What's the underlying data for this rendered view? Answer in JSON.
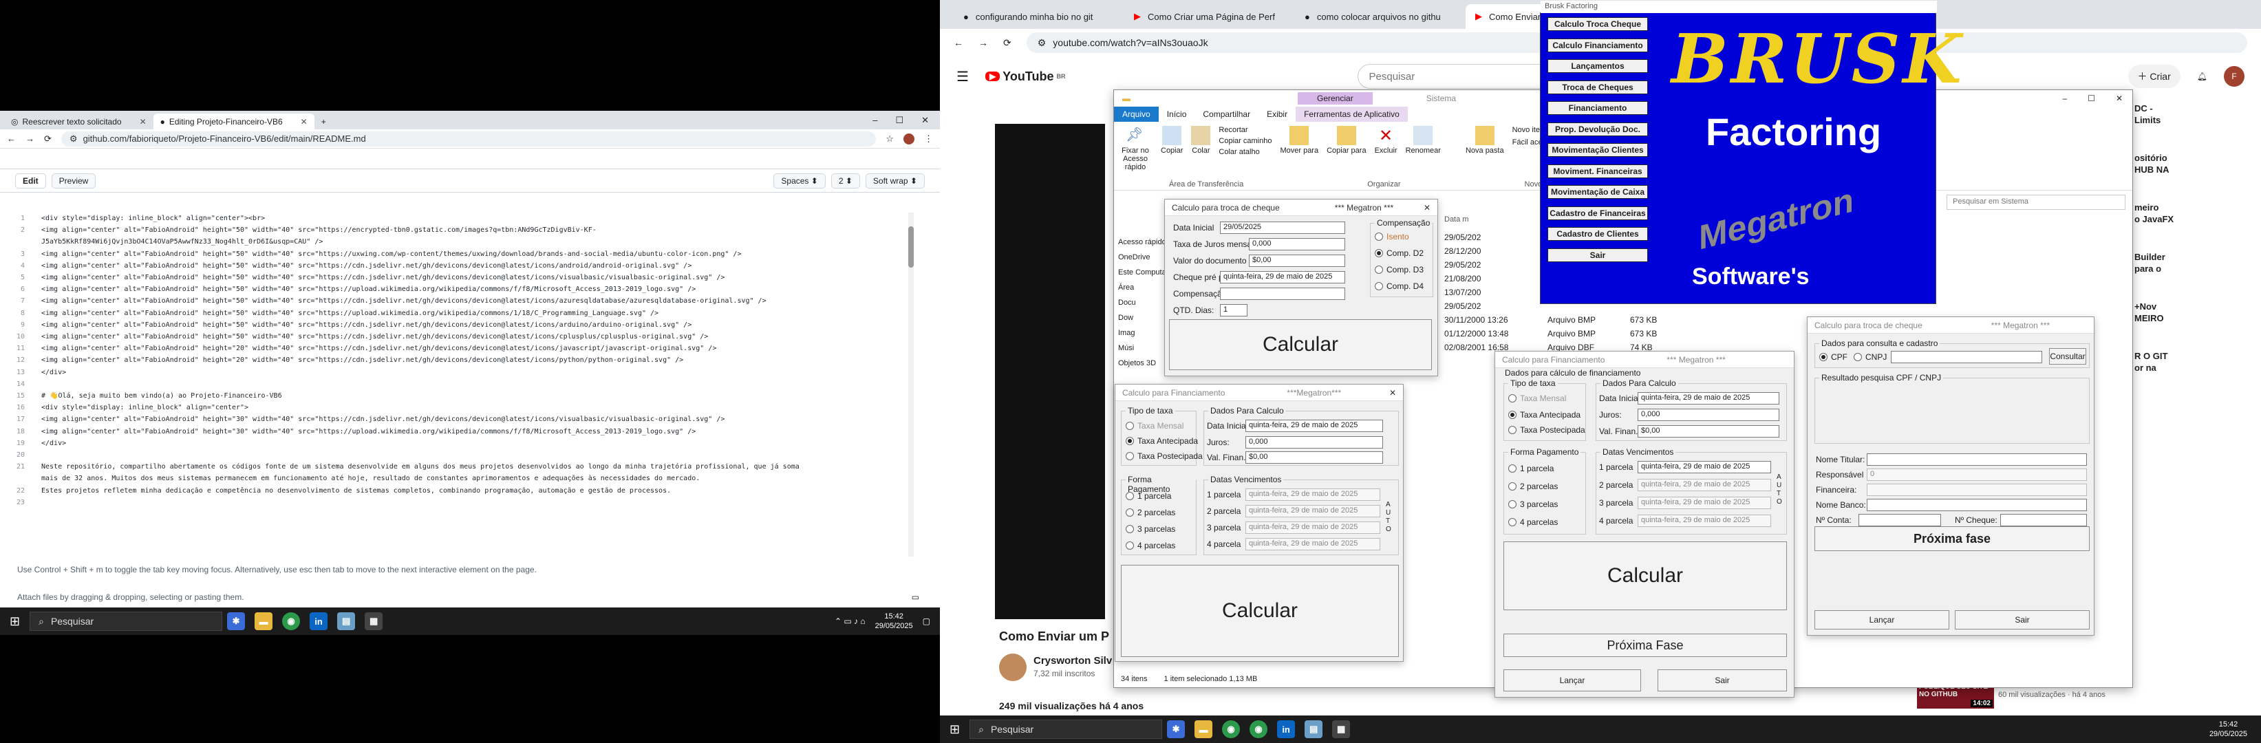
{
  "left": {
    "tabs": [
      {
        "label": "Reescrever texto solicitado",
        "active": false
      },
      {
        "label": "Editing Projeto-Financeiro-VB6",
        "active": true
      }
    ],
    "url": "github.com/fabioriqueto/Projeto-Financeiro-VB6/edit/main/README.md",
    "editor": {
      "edit_tab": "Edit",
      "preview_tab": "Preview",
      "indent_mode": "Spaces",
      "indent_size": "2",
      "wrap_mode": "Soft wrap"
    },
    "code_lines": [
      {
        "n": "1",
        "t": "<div style=\"display: inline_block\" align=\"center\"><br>"
      },
      {
        "n": "2",
        "t": "<img align=\"center\" alt=\"FabioAndroid\" height=\"50\" width=\"40\" src=\"https://encrypted-tbn0.gstatic.com/images?q=tbn:ANd9GcTzDigvBiv-KF-"
      },
      {
        "n": "",
        "t": "J5aYb5KkRf894Wi6jQvjn3bO4C14OVaP5AwwfNz33_Nog4hlt_0rD6I&usqp=CAU\" />"
      },
      {
        "n": "3",
        "t": "<img align=\"center\" alt=\"FabioAndroid\" height=\"50\" width=\"40\" src=\"https://uxwing.com/wp-content/themes/uxwing/download/brands-and-social-media/ubuntu-color-icon.png\" />"
      },
      {
        "n": "4",
        "t": "<img align=\"center\" alt=\"FabioAndroid\" height=\"50\" width=\"40\" src=\"https://cdn.jsdelivr.net/gh/devicons/devicon@latest/icons/android/android-original.svg\" />"
      },
      {
        "n": "5",
        "t": "<img align=\"center\" alt=\"FabioAndroid\" height=\"50\" width=\"40\" src=\"https://cdn.jsdelivr.net/gh/devicons/devicon@latest/icons/visualbasic/visualbasic-original.svg\" />"
      },
      {
        "n": "6",
        "t": "<img align=\"center\" alt=\"FabioAndroid\" height=\"50\" width=\"40\" src=\"https://upload.wikimedia.org/wikipedia/commons/f/f8/Microsoft_Access_2013-2019_logo.svg\" />"
      },
      {
        "n": "7",
        "t": "<img align=\"center\" alt=\"FabioAndroid\" height=\"50\" width=\"40\" src=\"https://cdn.jsdelivr.net/gh/devicons/devicon@latest/icons/azuresqldatabase/azuresqldatabase-original.svg\" />"
      },
      {
        "n": "8",
        "t": "<img align=\"center\" alt=\"FabioAndroid\" height=\"50\" width=\"40\" src=\"https://upload.wikimedia.org/wikipedia/commons/1/18/C_Programming_Language.svg\" />"
      },
      {
        "n": "9",
        "t": "<img align=\"center\" alt=\"FabioAndroid\" height=\"50\" width=\"40\" src=\"https://cdn.jsdelivr.net/gh/devicons/devicon@latest/icons/arduino/arduino-original.svg\" />"
      },
      {
        "n": "10",
        "t": "<img align=\"center\" alt=\"FabioAndroid\" height=\"50\" width=\"40\" src=\"https://cdn.jsdelivr.net/gh/devicons/devicon@latest/icons/cplusplus/cplusplus-original.svg\" />"
      },
      {
        "n": "11",
        "t": "<img align=\"center\" alt=\"FabioAndroid\" height=\"20\" width=\"40\" src=\"https://cdn.jsdelivr.net/gh/devicons/devicon@latest/icons/javascript/javascript-original.svg\" />"
      },
      {
        "n": "12",
        "t": "<img align=\"center\" alt=\"FabioAndroid\" height=\"20\" width=\"40\" src=\"https://cdn.jsdelivr.net/gh/devicons/devicon@latest/icons/python/python-original.svg\" />"
      },
      {
        "n": "13",
        "t": "</div>"
      },
      {
        "n": "14",
        "t": ""
      },
      {
        "n": "15",
        "t": "# 👋Olá, seja muito bem vindo(a) ao Projeto-Financeiro-VB6"
      },
      {
        "n": "16",
        "t": "<div style=\"display: inline_block\" align=\"center\">"
      },
      {
        "n": "17",
        "t": "<img align=\"center\" alt=\"FabioAndroid\" height=\"30\" width=\"40\" src=\"https://cdn.jsdelivr.net/gh/devicons/devicon@latest/icons/visualbasic/visualbasic-original.svg\" />"
      },
      {
        "n": "18",
        "t": "<img align=\"center\" alt=\"FabioAndroid\" height=\"30\" width=\"40\" src=\"https://upload.wikimedia.org/wikipedia/commons/f/f8/Microsoft_Access_2013-2019_logo.svg\" />"
      },
      {
        "n": "19",
        "t": "</div>"
      },
      {
        "n": "20",
        "t": ""
      },
      {
        "n": "21",
        "t": "Neste repositório, compartilho abertamente os códigos fonte de um sistema desenvolvide em alguns dos meus projetos desenvolvidos ao longo da minha trajetória profissional, que já soma"
      },
      {
        "n": "",
        "t": "mais de 32 anos. Muitos dos meus sistemas permanecem em funcionamento até hoje, resultado de constantes aprimoramentos e adequações às necessidades do mercado."
      },
      {
        "n": "22",
        "t": "Estes projetos refletem minha dedicação e competência no desenvolvimento de sistemas completos, combinando programação, automação e gestão de processos."
      },
      {
        "n": "23",
        "t": ""
      }
    ],
    "focus_note": "Use Control + Shift + m to toggle the tab key moving focus. Alternatively, use esc then tab to move to the next interactive element on the page.",
    "attach_note": "Attach files by dragging & dropping, selecting or pasting them.",
    "taskbar": {
      "search": "Pesquisar",
      "time": "15:42",
      "date": "29/05/2025"
    }
  },
  "right": {
    "tabs": [
      {
        "label": "configurando minha bio no git"
      },
      {
        "label": "Como Criar uma Página de Perf"
      },
      {
        "label": "como colocar arquivos no githu"
      },
      {
        "label": "Como Enviar um Projeto para o"
      }
    ],
    "url": "youtube.com/watch?v=aINs3ouaoJk",
    "youtube": {
      "logo": "YouTube",
      "country": "BR",
      "search_placeholder": "Pesquisar",
      "create": "Criar",
      "avatar": "F",
      "video_title": "Como Enviar um P",
      "channel": "Crysworton Silv",
      "subs": "7,32 mil inscritos",
      "views": "249 mil visualizações  há 4 anos",
      "side_titles": [
        "DC -",
        "Limits",
        "ositório",
        "HUB NA",
        "meiro",
        "o JavaFX",
        "Builder",
        "para o",
        "+Nov",
        "MEIRO",
        "R O GIT",
        "or na"
      ],
      "thumb_badge": "PUBLIQUE SEU SITE NO GITHUB",
      "thumb_time": "14:02",
      "thumb_views": "60 mil visualizações · há 4 anos"
    },
    "explorer": {
      "ribbon_tabs": [
        "Arquivo",
        "Início",
        "Compartilhar",
        "Exibir",
        "Ferramentas de Aplicativo"
      ],
      "context_tab": "Gerenciar",
      "context_title": "Sistema",
      "buttons": [
        "Fixar no Acesso rápido",
        "Copiar",
        "Colar",
        "Recortar",
        "Copiar caminho",
        "Colar atalho",
        "Mover para",
        "Copiar para",
        "Excluir",
        "Renomear",
        "Nova pasta",
        "Novo item",
        "Fácil acesso"
      ],
      "groups": [
        "Área de Transferência",
        "Organizar",
        "Novo"
      ],
      "search": "Pesquisar em Sistema",
      "nav": [
        "Acesso rápido",
        "OneDrive",
        "Este Computador",
        "Área",
        "Docu",
        "Dow",
        "Imag",
        "Músi",
        "Objetos 3D"
      ],
      "col_date": "Data m",
      "files": [
        {
          "date": "29/05/202",
          "type": "",
          "size": ""
        },
        {
          "date": "28/12/200",
          "type": "",
          "size": ""
        },
        {
          "date": "29/05/202",
          "type": "",
          "size": ""
        },
        {
          "date": "21/08/200",
          "type": "",
          "size": ""
        },
        {
          "date": "13/07/200",
          "type": "",
          "size": ""
        },
        {
          "date": "29/05/202",
          "type": "",
          "size": ""
        },
        {
          "date": "30/11/2000 13:26",
          "type": "Arquivo BMP",
          "size": "673 KB"
        },
        {
          "date": "01/12/2000 13:48",
          "type": "Arquivo BMP",
          "size": "673 KB"
        },
        {
          "date": "02/08/2001 16:58",
          "type": "Arquivo DBF",
          "size": "74 KB"
        }
      ],
      "status_items": "34 itens",
      "status_sel": "1 item selecionado  1,13 MB"
    },
    "brusk": {
      "title": "Brusk Factoring",
      "menu": [
        "Calculo Troca Cheque",
        "Calculo Financiamento",
        "Lançamentos",
        "Troca de Cheques",
        "Financiamento",
        "Prop. Devolução Doc.",
        "Movimentação Clientes",
        "Moviment. Financeiras",
        "Movimentação de Caixa",
        "Cadastro de Financeiras",
        "Cadastro de Clientes",
        "Sair"
      ],
      "logo_top": "BRUSK",
      "logo_mid": "Factoring",
      "logo_brand": "Megatron",
      "logo_bottom": "Software's"
    },
    "cheque": {
      "title": "Calculo para troca de cheque",
      "brand": "*** Megatron ***",
      "labels": [
        "Data Inicial",
        "Taxa de Juros mensal",
        "Valor do documento",
        "Cheque pré p/",
        "Compensação",
        "QTD. Dias:"
      ],
      "values": [
        "29/05/2025",
        "0,000",
        "$0,00",
        "quinta-feira, 29 de maio de 2025",
        "",
        "1"
      ],
      "comp_legend": "Compensação",
      "comp_options": [
        "Isento",
        "Comp. D2",
        "Comp. D3",
        "Comp. D4"
      ],
      "calc": "Calcular"
    },
    "fin1": {
      "title": "Calculo para Financiamento",
      "brand": "***Megatron***",
      "tipo_legend": "Tipo de taxa",
      "tipos": [
        "Taxa Mensal",
        "Taxa Antecipada",
        "Taxa Postecipada"
      ],
      "dados_legend": "Dados Para Calculo",
      "dados_labels": [
        "Data Inicial",
        "Juros:",
        "Val. Finan."
      ],
      "dados_values": [
        "quinta-feira, 29 de maio de 2025",
        "0,000",
        "$0,00"
      ],
      "forma_legend": "Forma Pagamento",
      "formas": [
        "1 parcela",
        "2 parcelas",
        "3 parcelas",
        "4 parcelas"
      ],
      "venc_legend": "Datas Vencimentos",
      "venc_labels": [
        "1 parcela",
        "2 parcela",
        "3 parcela",
        "4 parcela"
      ],
      "venc_values": [
        "quinta-feira, 29 de maio de 2025",
        "quinta-feira, 29 de maio de 2025",
        "quinta-feira, 29 de maio de 2025",
        "quinta-feira, 29 de maio de 2025"
      ],
      "auto": "AUTO",
      "calc": "Calcular"
    },
    "fin2": {
      "title": "Calculo para Financiamento",
      "brand": "*** Megatron ***",
      "top_legend": "Dados para cálculo de financiamento",
      "tipo_legend": "Tipo de taxa",
      "tipos": [
        "Taxa Mensal",
        "Taxa Antecipada",
        "Taxa Postecipada"
      ],
      "dados_legend": "Dados Para Calculo",
      "dados_labels": [
        "Data Inicial",
        "Juros:",
        "Val. Finan."
      ],
      "dados_values": [
        "quinta-feira, 29 de maio de 2025",
        "0,000",
        "$0,00"
      ],
      "forma_legend": "Forma Pagamento",
      "formas": [
        "1 parcela",
        "2 parcelas",
        "3 parcelas",
        "4 parcelas"
      ],
      "venc_legend": "Datas Vencimentos",
      "venc_labels": [
        "1 parcela",
        "2 parcela",
        "3 parcela",
        "4 parcela"
      ],
      "venc_values": [
        "quinta-feira, 29 de maio de 2025",
        "quinta-feira, 29 de maio de 2025",
        "quinta-feira, 29 de maio de 2025",
        "quinta-feira, 29 de maio de 2025"
      ],
      "auto": "AUTO",
      "calc": "Calcular",
      "next": "Próxima Fase",
      "back": "Lançar",
      "exit": "Sair"
    },
    "cad": {
      "title": "Calculo para troca de cheque",
      "brand": "*** Megatron ***",
      "consulta_legend": "Dados para consulta e cadastro",
      "cpf": "CPF",
      "cnpj": "CNPJ",
      "consultar": "Consultar",
      "result_legend": "Resultado pesquisa CPF / CNPJ",
      "labels": [
        "Nome Titular:",
        "Responsável",
        "Financeira:",
        "Nome Banco:",
        "Nº Conta:",
        "Nº Cheque:"
      ],
      "resp_value": "0",
      "next": "Próxima fase",
      "back": "Lançar",
      "exit": "Sair"
    },
    "taskbar": {
      "search": "Pesquisar",
      "time": "15:42",
      "date": "29/05/2025"
    }
  }
}
